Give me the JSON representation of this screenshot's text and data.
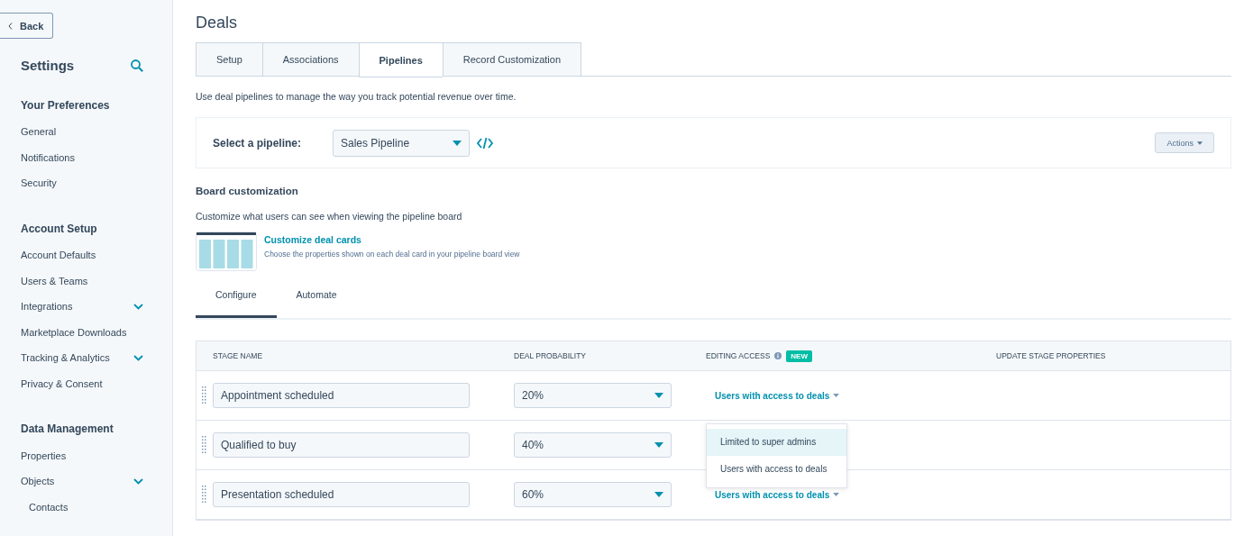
{
  "back_button": {
    "label": "Back"
  },
  "sidebar": {
    "title": "Settings",
    "sections": [
      {
        "heading": "Your Preferences",
        "items": [
          {
            "label": "General",
            "expandable": false
          },
          {
            "label": "Notifications",
            "expandable": false
          },
          {
            "label": "Security",
            "expandable": false
          }
        ]
      },
      {
        "heading": "Account Setup",
        "items": [
          {
            "label": "Account Defaults",
            "expandable": false
          },
          {
            "label": "Users & Teams",
            "expandable": false
          },
          {
            "label": "Integrations",
            "expandable": true
          },
          {
            "label": "Marketplace Downloads",
            "expandable": false
          },
          {
            "label": "Tracking & Analytics",
            "expandable": true
          },
          {
            "label": "Privacy & Consent",
            "expandable": false
          }
        ]
      },
      {
        "heading": "Data Management",
        "items": [
          {
            "label": "Properties",
            "expandable": false
          },
          {
            "label": "Objects",
            "expandable": true,
            "children": [
              {
                "label": "Contacts",
                "expandable": false
              }
            ]
          }
        ]
      }
    ]
  },
  "page_title": "Deals",
  "tabs": [
    {
      "label": "Setup",
      "selected": false
    },
    {
      "label": "Associations",
      "selected": false
    },
    {
      "label": "Pipelines",
      "selected": true
    },
    {
      "label": "Record Customization",
      "selected": false
    }
  ],
  "description": "Use deal pipelines to manage the way you track potential revenue over time.",
  "pipeline_select": {
    "label": "Select a pipeline:",
    "value": "Sales Pipeline",
    "actions_button": "Actions"
  },
  "board_customization": {
    "heading": "Board customization",
    "description": "Customize what users can see when viewing the pipeline board",
    "link": "Customize deal cards",
    "link_description": "Choose the properties shown on each deal card in your pipeline board view"
  },
  "subtabs": [
    {
      "label": "Configure",
      "selected": true
    },
    {
      "label": "Automate",
      "selected": false
    }
  ],
  "table": {
    "columns": [
      {
        "label": "STAGE NAME"
      },
      {
        "label": "DEAL PROBABILITY"
      },
      {
        "label": "EDITING ACCESS",
        "badge": "NEW"
      },
      {
        "label": "UPDATE STAGE PROPERTIES"
      }
    ],
    "rows": [
      {
        "stage_name": "Appointment scheduled",
        "probability": "20%",
        "editing_access": "Users with access to deals"
      },
      {
        "stage_name": "Qualified to buy",
        "probability": "40%"
      },
      {
        "stage_name": "Presentation scheduled",
        "probability": "60%",
        "editing_access": "Users with access to deals"
      }
    ]
  },
  "access_menu": {
    "options": [
      {
        "label": "Limited to super admins",
        "selected": true
      },
      {
        "label": "Users with access to deals",
        "selected": false
      }
    ]
  }
}
